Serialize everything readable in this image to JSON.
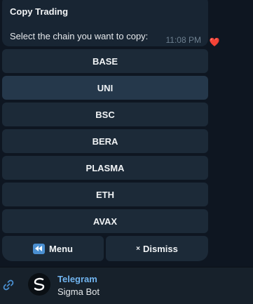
{
  "message": {
    "title": "Copy Trading",
    "text": "Select the chain you want to copy:",
    "time": "11:08 PM",
    "reaction": "❤️"
  },
  "keyboard": {
    "buttons": [
      {
        "label": "BASE"
      },
      {
        "label": "UNI"
      },
      {
        "label": "BSC"
      },
      {
        "label": "BERA"
      },
      {
        "label": "PLASMA"
      },
      {
        "label": "ETH"
      },
      {
        "label": "AVAX"
      }
    ],
    "menu_label": "Menu",
    "dismiss_label": "Dismiss",
    "dismiss_glyph": "×"
  },
  "footer": {
    "title": "Telegram",
    "subtitle": "Sigma Bot"
  },
  "colors": {
    "background": "#0e1621",
    "bubble": "#182533",
    "button": "#1c2a38",
    "button_hover": "#25384b",
    "accent": "#71b4ef"
  }
}
